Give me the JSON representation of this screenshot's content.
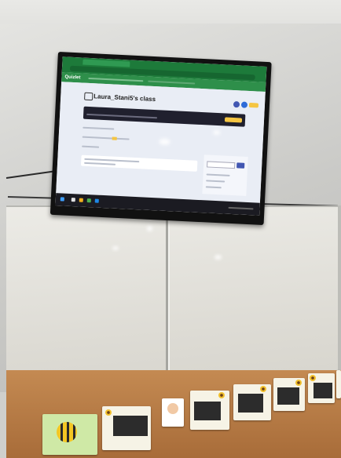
{
  "scene": {
    "description_tag": "",
    "tv_screen": {
      "browser_tab_label": "",
      "app_logo": "Quizlet",
      "class_title": "Laura_Stani5's class",
      "banner_text": "",
      "brand_color": "#2e8f4a",
      "banner_color": "#20202e",
      "accent_color": "#f5c542"
    },
    "wall_cards": [
      {
        "icon": "bee-card"
      },
      {
        "icon": "sunflower-chalkboard-card"
      },
      {
        "icon": "sunflower-chalkboard-card"
      },
      {
        "icon": "portrait-card"
      },
      {
        "icon": "sunflower-chalkboard-card"
      },
      {
        "icon": "sunflower-chalkboard-card"
      },
      {
        "icon": "sunflower-chalkboard-card"
      },
      {
        "icon": "sunflower-chalkboard-card"
      }
    ]
  }
}
